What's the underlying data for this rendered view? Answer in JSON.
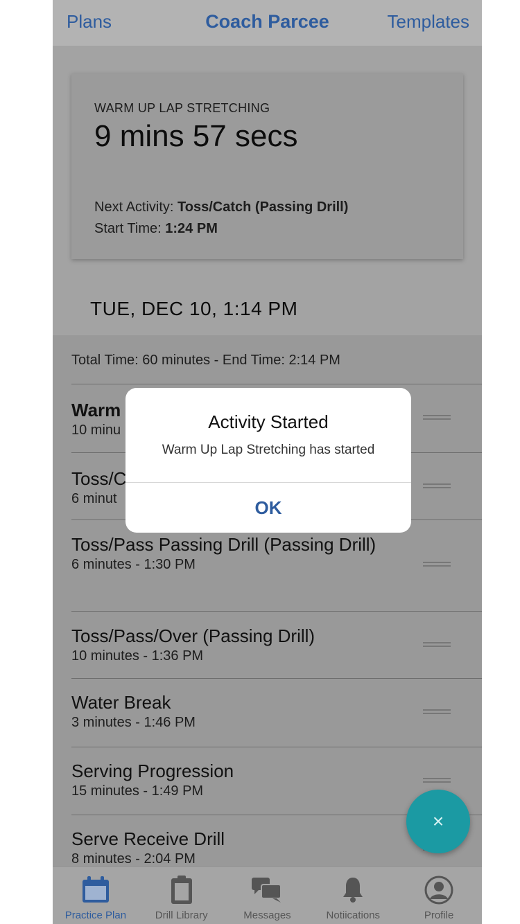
{
  "header": {
    "left_label": "Plans",
    "title": "Coach Parcee",
    "right_label": "Templates"
  },
  "timer_card": {
    "activity_name": "WARM UP LAP STRETCHING",
    "timer": "9 mins 57 secs",
    "next_activity_label": "Next Activity:",
    "next_activity_value": "Toss/Catch (Passing Drill)",
    "start_time_label": "Start Time:",
    "start_time_value": "1:24 PM"
  },
  "schedule": {
    "date_heading": "TUE, DEC 10, 1:14 PM",
    "total_time": "Total Time: 60 minutes - End Time: 2:14 PM",
    "activities": [
      {
        "title": "Warm",
        "subtitle": "10 minu"
      },
      {
        "title": "Toss/C",
        "subtitle": "6 minut"
      },
      {
        "title": "Toss/Pass Passing Drill (Passing Drill)",
        "subtitle": "6 minutes - 1:30 PM"
      },
      {
        "title": "Toss/Pass/Over (Passing Drill)",
        "subtitle": "10 minutes - 1:36 PM"
      },
      {
        "title": "Water Break",
        "subtitle": "3 minutes - 1:46 PM"
      },
      {
        "title": "Serving Progression",
        "subtitle": "15 minutes - 1:49 PM"
      },
      {
        "title": "Serve Receive Drill",
        "subtitle": "8 minutes - 2:04 PM"
      }
    ]
  },
  "fab": {
    "icon": "close-icon",
    "glyph": "×"
  },
  "tabs": [
    {
      "label": "Practice Plan",
      "icon": "calendar-icon"
    },
    {
      "label": "Drill Library",
      "icon": "clipboard-icon"
    },
    {
      "label": "Messages",
      "icon": "chat-bubbles-icon"
    },
    {
      "label": "Notiications",
      "icon": "bell-icon"
    },
    {
      "label": "Profile",
      "icon": "profile-icon"
    }
  ],
  "dialog": {
    "title": "Activity Started",
    "message": "Warm Up Lap Stretching has started",
    "ok_label": "OK"
  },
  "colors": {
    "accent": "#2e5c9e",
    "fab": "#1b9aa3",
    "overlay_background": "#a3a3a3"
  }
}
